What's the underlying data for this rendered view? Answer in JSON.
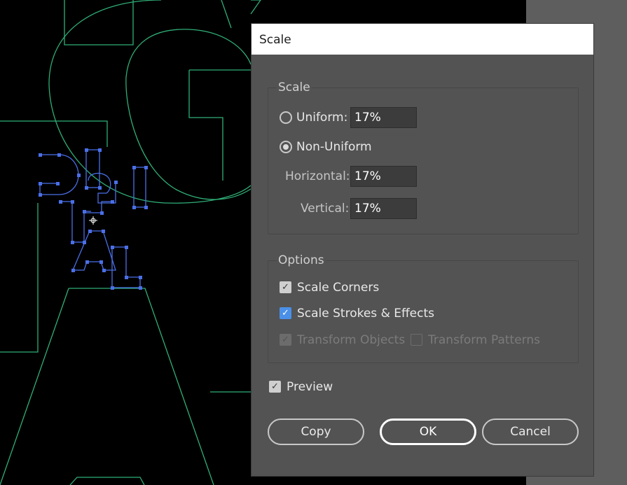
{
  "dialog": {
    "title": "Scale",
    "scale_group": {
      "legend": "Scale",
      "uniform": {
        "label": "Uniform:",
        "value": "17%",
        "selected": false
      },
      "non_uniform": {
        "label": "Non-Uniform",
        "selected": true
      },
      "horizontal": {
        "label": "Horizontal:",
        "value": "17%"
      },
      "vertical": {
        "label": "Vertical:",
        "value": "17%"
      }
    },
    "options_group": {
      "legend": "Options",
      "scale_corners": {
        "label": "Scale Corners",
        "checked": true
      },
      "scale_strokes": {
        "label": "Scale Strokes & Effects",
        "checked": true
      },
      "transform_objects": {
        "label": "Transform Objects",
        "checked": true,
        "enabled": false
      },
      "transform_patterns": {
        "label": "Transform Patterns",
        "checked": false,
        "enabled": false
      }
    },
    "preview": {
      "label": "Preview",
      "checked": true
    },
    "buttons": {
      "copy": "Copy",
      "ok": "OK",
      "cancel": "Cancel"
    }
  },
  "colors": {
    "artwork_outline": "#2fae76",
    "selection": "#4a6fe8",
    "accent_checkbox": "#4a90e8"
  }
}
